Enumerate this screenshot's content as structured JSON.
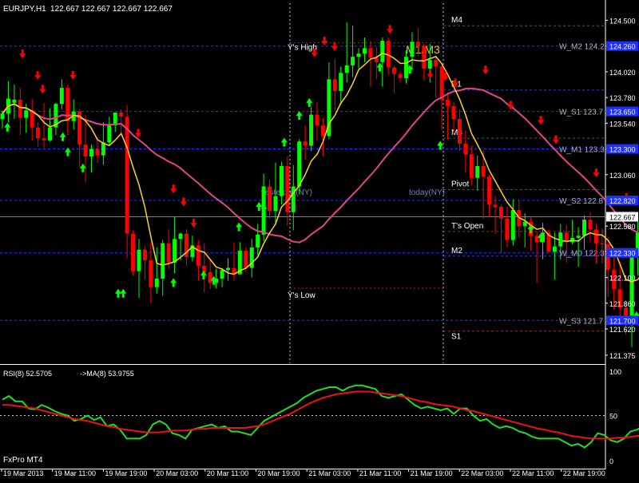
{
  "header": {
    "symbol_label": "EURJPY,H1",
    "ohlc": "122.667 122.667 122.667 122.667"
  },
  "footer": {
    "broker": "FxPro MT4"
  },
  "colors": {
    "background": "#000000",
    "bull_candle": "#00ff00",
    "bear_candle": "#ff0000",
    "ma_fast": "#ffd21e",
    "ma_slow": "#e0458a",
    "rsi": "#22dd22",
    "rsi_ma": "#ee1111",
    "pivot_blue": "#1e37ff",
    "pivot_red": "#b41e1e",
    "pivot_green": "#1e7a1e",
    "price_tag_bg": "#1e30ff"
  },
  "chart_data": [
    {
      "type": "candlestick",
      "title": "EURJPY,H1",
      "ylim": [
        121.3,
        124.66
      ],
      "current_price": 122.667,
      "y_ticks": [
        121.375,
        121.62,
        121.86,
        122.1,
        122.34,
        122.58,
        122.82,
        123.06,
        123.3,
        123.54,
        123.78,
        124.02,
        124.26,
        124.5
      ],
      "x_labels": [
        "19 Mar 2013",
        "19 Mar 11:00",
        "19 Mar 19:00",
        "20 Mar 03:00",
        "20 Mar 11:00",
        "20 Mar 19:00",
        "21 Mar 03:00",
        "21 Mar 11:00",
        "21 Mar 19:00",
        "22 Mar 03:00",
        "22 Mar 11:00",
        "22 Mar 19:00"
      ],
      "candles": {
        "open": [
          123.58,
          123.63,
          123.73,
          123.76,
          123.59,
          123.66,
          123.5,
          123.4,
          123.38,
          123.5,
          123.72,
          123.87,
          123.56,
          123.65,
          123.34,
          123.23,
          123.3,
          123.24,
          123.36,
          123.52,
          123.64,
          123.6,
          122.51,
          122.16,
          122.36,
          122.26,
          122.01,
          122.09,
          122.42,
          122.24,
          122.46,
          122.51,
          122.29,
          122.4,
          122.21,
          122.15,
          122.05,
          122.09,
          122.17,
          122.19,
          122.13,
          122.35,
          122.19,
          122.38,
          122.5,
          122.95,
          122.72,
          122.86,
          123.14,
          122.71,
          122.95,
          123.37,
          123.33,
          123.62,
          123.52,
          123.42,
          123.95,
          123.84,
          124.01,
          124.08,
          124.16,
          124.19,
          124.24,
          124.15,
          124.11,
          124.31,
          124.06,
          124.0,
          123.96,
          124.16,
          124.3,
          124.26,
          124.05,
          124.13,
          124.07,
          123.76,
          123.7,
          123.58,
          123.35,
          123.25,
          123.03,
          123.14,
          123.04,
          122.78,
          122.76,
          122.65,
          122.45,
          122.73,
          122.58,
          122.62,
          122.49,
          122.43,
          122.52,
          122.34,
          122.39,
          122.52,
          122.43,
          122.47,
          122.49,
          122.64,
          122.55,
          122.42,
          122.41,
          122.17,
          121.99,
          121.82,
          121.68,
          122.3,
          122.52,
          122.65,
          122.97,
          122.84,
          122.85,
          122.62,
          122.6,
          122.52,
          122.57
        ],
        "high": [
          123.66,
          123.93,
          123.9,
          123.87,
          123.72,
          123.77,
          123.55,
          123.73,
          123.68,
          123.73,
          123.95,
          123.9,
          123.76,
          123.67,
          123.62,
          123.34,
          123.41,
          123.55,
          123.6,
          123.62,
          123.67,
          123.71,
          122.54,
          122.46,
          122.4,
          122.43,
          122.38,
          122.45,
          122.55,
          122.67,
          122.52,
          122.55,
          122.49,
          122.45,
          122.42,
          122.27,
          122.18,
          122.19,
          122.28,
          122.43,
          122.43,
          122.38,
          122.46,
          122.6,
          123.07,
          123.01,
          123.17,
          123.18,
          123.23,
          123.15,
          123.39,
          123.52,
          123.69,
          123.74,
          123.59,
          124.11,
          124.14,
          124.07,
          124.48,
          124.45,
          124.24,
          124.34,
          124.31,
          124.25,
          124.34,
          124.34,
          124.08,
          124.03,
          124.22,
          124.39,
          124.43,
          124.28,
          124.28,
          124.17,
          124.1,
          123.83,
          123.74,
          123.67,
          123.47,
          123.33,
          123.24,
          123.29,
          123.06,
          122.86,
          122.78,
          122.76,
          122.83,
          122.82,
          122.7,
          122.66,
          122.53,
          122.61,
          122.55,
          122.52,
          122.6,
          122.59,
          122.64,
          122.57,
          122.68,
          122.71,
          122.6,
          122.56,
          122.48,
          122.36,
          122.25,
          121.89,
          122.3,
          122.67,
          122.72,
          123.12,
          123.05,
          123.25,
          122.97,
          122.99,
          122.71,
          122.68,
          122.7
        ],
        "low": [
          123.49,
          123.55,
          123.58,
          123.43,
          123.45,
          123.38,
          123.32,
          123.31,
          123.37,
          123.43,
          123.67,
          123.43,
          123.48,
          123.13,
          122.99,
          123.08,
          123.17,
          123.15,
          123.33,
          123.46,
          123.44,
          122.28,
          122.12,
          121.91,
          122.08,
          121.86,
          121.95,
          121.93,
          122.18,
          122.14,
          122.26,
          122.21,
          122.25,
          122.07,
          121.96,
          121.99,
          122.0,
          122.01,
          122.07,
          122.07,
          122.13,
          122.15,
          122.1,
          122.31,
          122.44,
          122.65,
          122.61,
          122.78,
          122.58,
          122.54,
          122.88,
          123.2,
          123.28,
          123.38,
          123.23,
          123.39,
          123.65,
          123.71,
          123.92,
          123.97,
          124.05,
          124.11,
          123.88,
          123.95,
          123.88,
          123.99,
          123.82,
          123.92,
          123.91,
          124.05,
          124.17,
          123.94,
          123.92,
          123.78,
          123.48,
          123.39,
          123.44,
          123.28,
          123.08,
          122.96,
          122.91,
          122.65,
          122.66,
          122.51,
          122.33,
          122.38,
          122.4,
          122.47,
          122.38,
          122.35,
          122.05,
          122.27,
          122.34,
          122.08,
          122.27,
          122.24,
          122.41,
          122.2,
          122.36,
          122.43,
          122.23,
          122.23,
          121.92,
          121.8,
          121.69,
          121.57,
          121.45,
          122.12,
          122.41,
          122.48,
          122.76,
          122.56,
          122.54,
          122.44,
          122.47,
          122.45,
          122.52
        ],
        "close": [
          123.63,
          123.77,
          123.76,
          123.59,
          123.66,
          123.5,
          123.4,
          123.38,
          123.5,
          123.72,
          123.87,
          123.56,
          123.65,
          123.34,
          123.23,
          123.3,
          123.24,
          123.36,
          123.52,
          123.64,
          123.6,
          122.51,
          122.16,
          122.36,
          122.26,
          122.01,
          122.09,
          122.42,
          122.24,
          122.46,
          122.51,
          122.29,
          122.4,
          122.21,
          122.15,
          122.05,
          122.09,
          122.17,
          122.19,
          122.13,
          122.35,
          122.19,
          122.38,
          122.5,
          122.95,
          122.72,
          122.86,
          123.14,
          122.71,
          122.95,
          123.37,
          123.33,
          123.62,
          123.52,
          123.42,
          123.95,
          123.84,
          124.01,
          124.08,
          124.16,
          124.19,
          124.24,
          124.15,
          124.11,
          124.31,
          124.06,
          124.0,
          123.96,
          124.16,
          124.3,
          124.26,
          124.05,
          124.13,
          124.07,
          123.76,
          123.7,
          123.58,
          123.35,
          123.25,
          123.03,
          123.14,
          123.04,
          122.78,
          122.76,
          122.65,
          122.45,
          122.73,
          122.58,
          122.62,
          122.49,
          122.43,
          122.52,
          122.34,
          122.39,
          122.52,
          122.43,
          122.47,
          122.49,
          122.64,
          122.55,
          122.42,
          122.41,
          122.17,
          121.99,
          121.82,
          121.68,
          122.3,
          122.52,
          122.65,
          122.97,
          122.84,
          122.85,
          122.62,
          122.6,
          122.52,
          122.57,
          122.67
        ]
      },
      "up_arrows": [
        [
          1,
          123.5
        ],
        [
          12,
          123.41
        ],
        [
          13,
          123.27
        ],
        [
          16,
          123.12
        ],
        [
          23,
          121.95
        ],
        [
          24,
          121.95
        ],
        [
          34,
          122.05
        ],
        [
          40,
          122.12
        ],
        [
          42,
          122.07
        ],
        [
          47,
          122.57
        ],
        [
          51,
          122.76
        ],
        [
          52,
          122.74
        ],
        [
          56,
          123.36
        ],
        [
          59,
          123.61
        ],
        [
          61,
          123.73
        ],
        [
          75,
          124.06
        ],
        [
          81,
          124.04
        ],
        [
          87,
          123.33
        ],
        [
          105,
          122.55
        ],
        [
          107,
          122.47
        ],
        [
          111,
          122.43
        ],
        [
          126,
          121.74
        ],
        [
          127,
          121.65
        ],
        [
          131,
          122.33
        ],
        [
          141,
          122.47
        ]
      ],
      "down_arrows": [
        [
          4,
          124.19
        ],
        [
          7,
          123.99
        ],
        [
          8,
          123.86
        ],
        [
          14,
          123.99
        ],
        [
          27,
          123.45
        ],
        [
          34,
          122.93
        ],
        [
          36,
          122.81
        ],
        [
          38,
          122.61
        ],
        [
          62,
          124.2
        ],
        [
          64,
          124.31
        ],
        [
          66,
          124.26
        ],
        [
          72,
          124.75
        ],
        [
          77,
          124.42
        ],
        [
          85,
          124.0
        ],
        [
          88,
          123.98
        ],
        [
          90,
          123.92
        ],
        [
          96,
          124.04
        ],
        [
          101,
          123.71
        ],
        [
          107,
          123.57
        ],
        [
          110,
          123.39
        ],
        [
          118,
          123.08
        ],
        [
          124,
          122.85
        ],
        [
          134,
          122.51
        ],
        [
          138,
          122.51
        ],
        [
          144,
          122.48
        ]
      ],
      "pivot_lines": [
        {
          "name": "M4",
          "level": 124.45,
          "color": "green"
        },
        {
          "name": "W_M2",
          "level": 124.26,
          "color": "blue",
          "value_label": "124.2"
        },
        {
          "name": "R1",
          "level": 123.85,
          "color": "blue"
        },
        {
          "name": "W_S1",
          "level": 123.65,
          "color": "blue",
          "value_label": "123.7"
        },
        {
          "name": "M3",
          "level": 123.4,
          "color": "green"
        },
        {
          "name": "W_M1",
          "level": 123.3,
          "color": "blue",
          "value_label": "123.3"
        },
        {
          "name": "Pivot",
          "level": 122.92,
          "color": "red"
        },
        {
          "name": "W_S2",
          "level": 122.82,
          "color": "blue",
          "value_label": "122.8"
        },
        {
          "name": "T's Open",
          "level": 122.53,
          "color": "red"
        },
        {
          "name": "W_M0",
          "level": 122.33,
          "color": "blue",
          "value_label": "122.3"
        },
        {
          "name": "M2",
          "level": 122.3,
          "color": "blue"
        },
        {
          "name": "W_S3",
          "level": 121.7,
          "color": "blue",
          "value_label": "121.7"
        },
        {
          "name": "S1",
          "level": 121.6,
          "color": "red"
        }
      ],
      "price_tags": [
        124.26,
        123.65,
        123.3,
        122.82,
        122.33,
        121.7
      ],
      "day_separators": [
        "yesterday",
        "today"
      ],
      "chart_labels": {
        "ys_high": "Y's High",
        "ys_low": "Y's Low",
        "m1m3": "M1/M3",
        "yesterday": "yesterday(NY)",
        "today": "today(NY)"
      }
    },
    {
      "type": "line",
      "title": "RSI(8) 52.5705",
      "ma_label": "->MA(8) 53.9755",
      "ylim": [
        0,
        100
      ],
      "y_ticks": [
        0,
        50,
        100
      ],
      "levels": [
        50
      ],
      "series": [
        {
          "name": "RSI(8)",
          "color": "rsi",
          "values": [
            68,
            72,
            66,
            66,
            58,
            57,
            62,
            59,
            55,
            52,
            50,
            44,
            46,
            50,
            45,
            48,
            38,
            40,
            34,
            24,
            24,
            24,
            28,
            40,
            44,
            40,
            30,
            28,
            24,
            34,
            36,
            38,
            40,
            36,
            38,
            32,
            32,
            30,
            28,
            36,
            44,
            48,
            52,
            56,
            60,
            64,
            70,
            74,
            78,
            80,
            82,
            82,
            78,
            82,
            84,
            84,
            82,
            80,
            72,
            70,
            72,
            74,
            68,
            62,
            58,
            60,
            58,
            56,
            58,
            52,
            58,
            58,
            50,
            44,
            46,
            40,
            36,
            38,
            36,
            32,
            30,
            26,
            24,
            24,
            24,
            24,
            20,
            16,
            18,
            14,
            20,
            30,
            28,
            22,
            20,
            24,
            32,
            34,
            38,
            30,
            30,
            36,
            30,
            26,
            30,
            54,
            64,
            72,
            70,
            64,
            66,
            68,
            66,
            60,
            54,
            52,
            52,
            53
          ]
        },
        {
          "name": "->MA(8)",
          "color": "rsi_ma",
          "values": [
            62,
            62,
            61,
            60,
            59,
            58,
            56,
            54,
            52,
            50,
            48,
            46,
            45,
            44,
            42,
            40,
            38,
            37,
            35,
            34,
            33,
            32,
            31,
            31,
            31,
            32,
            33,
            33,
            33,
            34,
            35,
            35,
            36,
            36,
            36,
            36,
            36,
            36,
            37,
            38,
            40,
            43,
            46,
            49,
            52,
            56,
            60,
            64,
            67,
            70,
            72,
            74,
            75,
            76,
            77,
            77,
            77,
            76,
            75,
            74,
            73,
            72,
            70,
            68,
            66,
            65,
            63,
            62,
            61,
            60,
            58,
            56,
            55,
            53,
            51,
            49,
            47,
            45,
            43,
            41,
            39,
            37,
            35,
            34,
            32,
            31,
            29,
            27,
            26,
            25,
            24,
            24,
            24,
            24,
            25,
            25,
            26,
            27,
            28,
            29,
            30,
            31,
            32,
            33,
            34,
            37,
            40,
            44,
            48,
            52,
            56,
            58,
            59,
            58,
            57,
            55,
            54,
            54
          ]
        }
      ]
    }
  ]
}
